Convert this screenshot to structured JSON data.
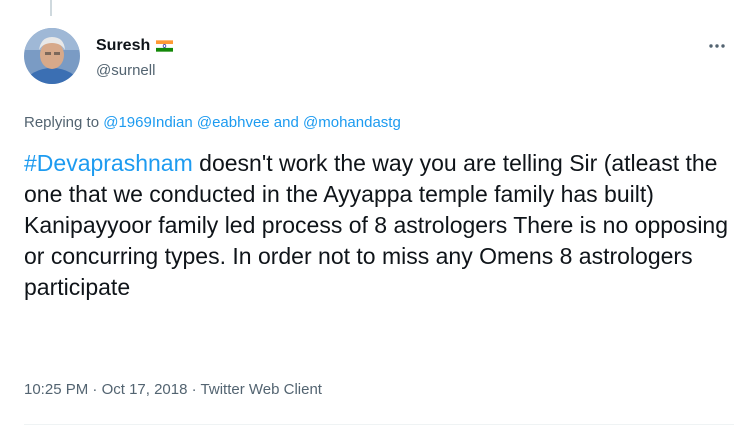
{
  "tweet": {
    "author": {
      "name": "Suresh",
      "handle": "@surnell",
      "flag_icon": "india-flag-icon",
      "avatar_icon": "profile-photo"
    },
    "replying_to": {
      "prefix": "Replying to ",
      "mentions": [
        "@1969Indian",
        "@eabhvee",
        "@mohandastg"
      ],
      "joiner": " and "
    },
    "text": {
      "hashtag": "#Devaprashnam",
      "body": " doesn't work the way you are telling Sir (atleast the one that we conducted in the Ayyappa temple family has built) Kanipayyoor family led process of 8 astrologers There is no opposing or concurring types. In order not to miss any Omens 8 astrologers participate"
    },
    "meta": {
      "time": "10:25 PM",
      "separator": " · ",
      "date": "Oct 17, 2018",
      "source": "Twitter Web Client"
    },
    "more_icon": "more-horizontal-icon"
  },
  "colors": {
    "link": "#1d9bf0",
    "secondary_text": "#536471",
    "primary_text": "#0f1419"
  }
}
